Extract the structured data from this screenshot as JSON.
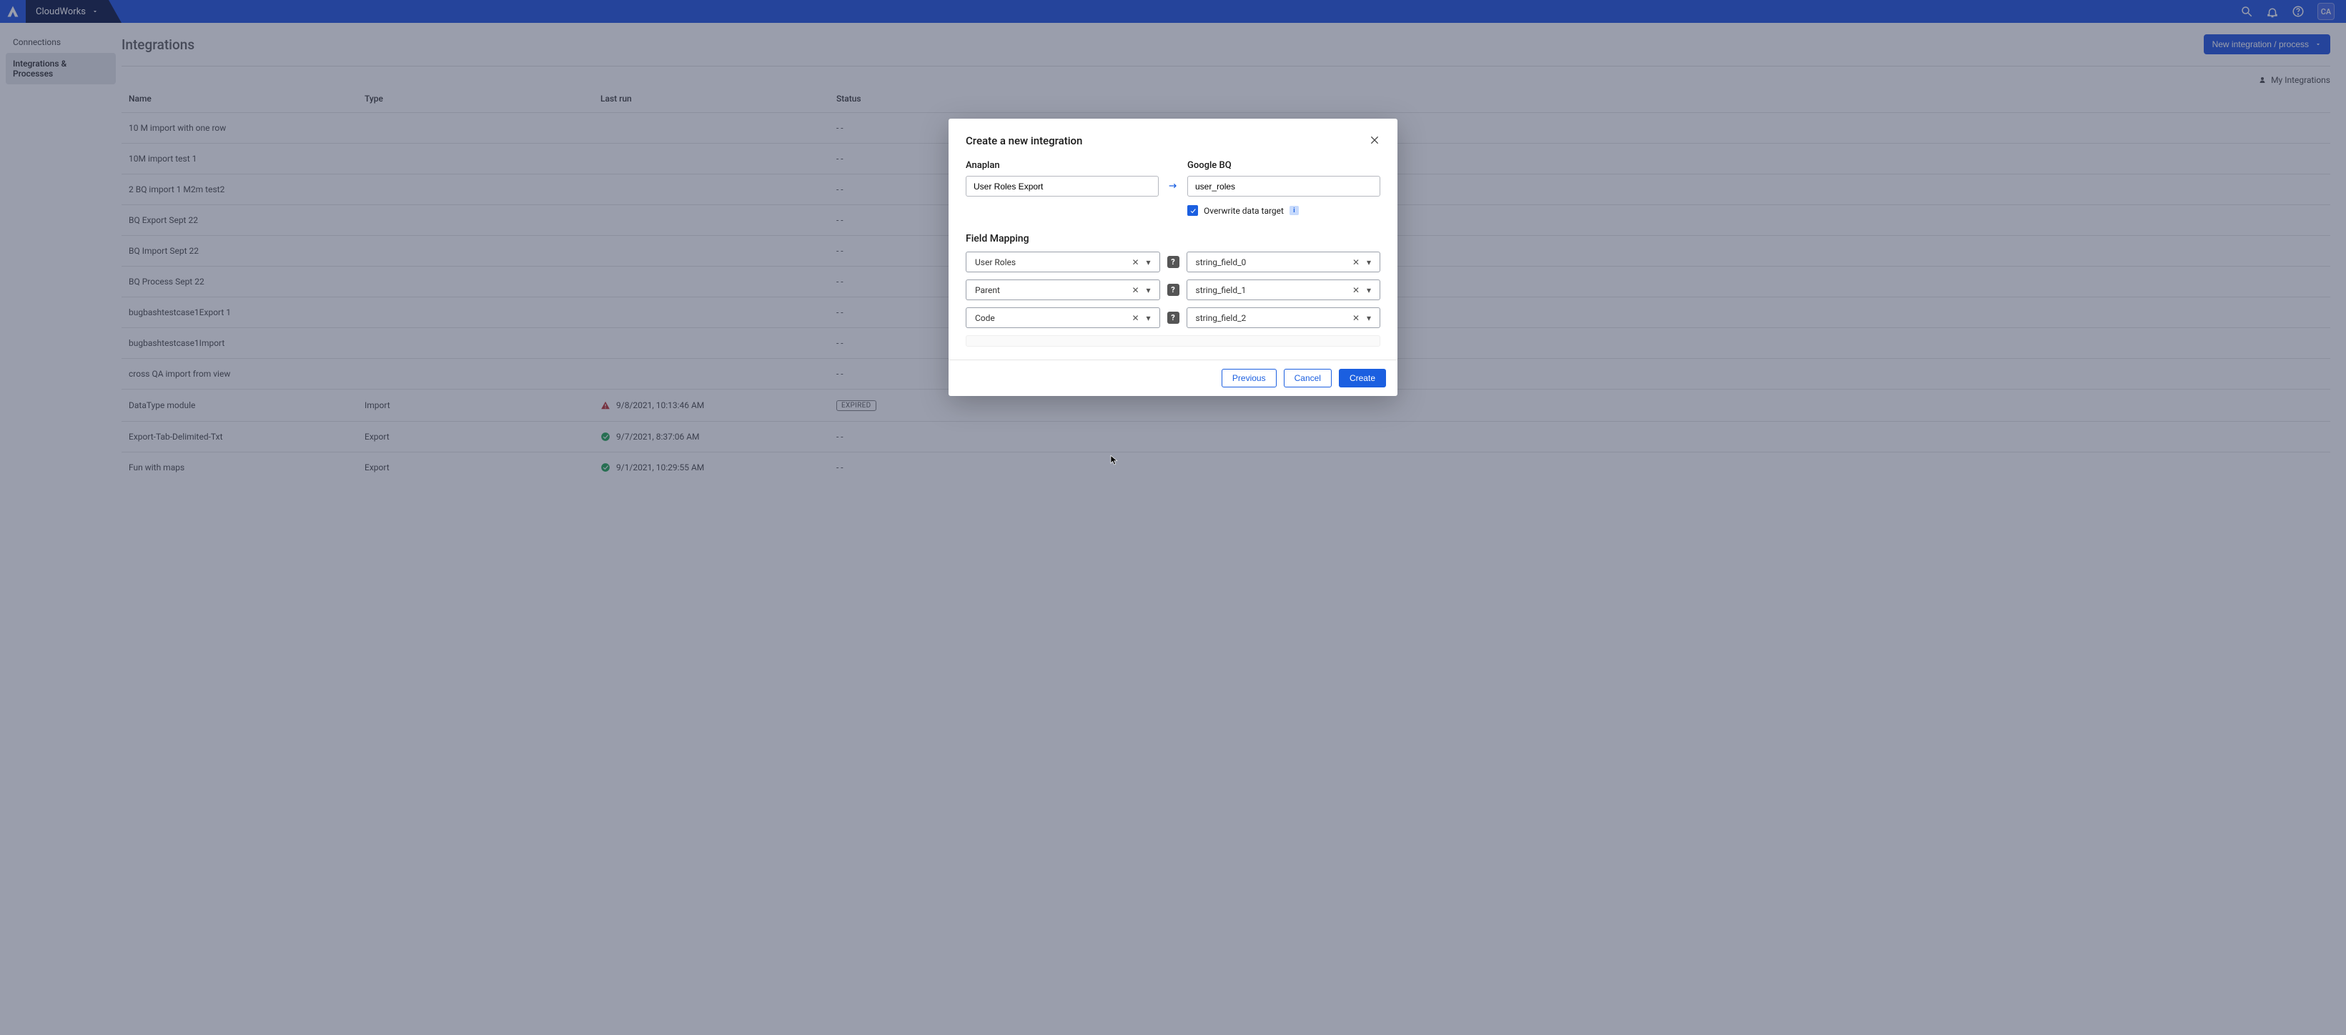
{
  "workspace": "CloudWorks",
  "avatar": "CA",
  "sidebar": {
    "items": [
      {
        "label": "Connections"
      },
      {
        "label": "Integrations & Processes"
      }
    ],
    "active": 1
  },
  "page": {
    "title": "Integrations",
    "new_button": "New integration / process",
    "my_integrations": "My Integrations"
  },
  "table": {
    "columns": [
      "Name",
      "Type",
      "Last run",
      "Status"
    ],
    "rows": [
      {
        "name": "10 M import with one row",
        "type": "",
        "run_icon": "",
        "last_run": "",
        "status": "- -"
      },
      {
        "name": "10M import test 1",
        "type": "",
        "run_icon": "",
        "last_run": "",
        "status": "- -"
      },
      {
        "name": "2 BQ import 1 M2m test2",
        "type": "",
        "run_icon": "",
        "last_run": "",
        "status": "- -"
      },
      {
        "name": "BQ Export Sept 22",
        "type": "",
        "run_icon": "",
        "last_run": "",
        "status": "- -"
      },
      {
        "name": "BQ Import Sept 22",
        "type": "",
        "run_icon": "",
        "last_run": "",
        "status": "- -"
      },
      {
        "name": "BQ Process Sept 22",
        "type": "",
        "run_icon": "",
        "last_run": "",
        "status": "- -"
      },
      {
        "name": "bugbashtestcase1Export 1",
        "type": "",
        "run_icon": "",
        "last_run": "",
        "status": "- -"
      },
      {
        "name": "bugbashtestcase1Import",
        "type": "",
        "run_icon": "",
        "last_run": "",
        "status": "- -"
      },
      {
        "name": "cross QA import from view",
        "type": "",
        "run_icon": "",
        "last_run": "",
        "status": "- -"
      },
      {
        "name": "DataType module",
        "type": "Import",
        "run_icon": "error",
        "last_run": "9/8/2021, 10:13:46 AM",
        "status": "EXPIRED"
      },
      {
        "name": "Export-Tab-Delimited-Txt",
        "type": "Export",
        "run_icon": "ok",
        "last_run": "9/7/2021, 8:37:06 AM",
        "status": "- -"
      },
      {
        "name": "Fun with maps",
        "type": "Export",
        "run_icon": "ok",
        "last_run": "9/1/2021, 10:29:55 AM",
        "status": "- -"
      }
    ]
  },
  "modal": {
    "title": "Create a new integration",
    "anaplan_label": "Anaplan",
    "anaplan_value": "User Roles Export",
    "bq_label": "Google BQ",
    "bq_value": "user_roles",
    "overwrite_label": "Overwrite data target",
    "overwrite_checked": true,
    "mapping_title": "Field Mapping",
    "mappings": [
      {
        "left": "User Roles",
        "right": "string_field_0"
      },
      {
        "left": "Parent",
        "right": "string_field_1"
      },
      {
        "left": "Code",
        "right": "string_field_2"
      }
    ],
    "previous": "Previous",
    "cancel": "Cancel",
    "create": "Create"
  }
}
